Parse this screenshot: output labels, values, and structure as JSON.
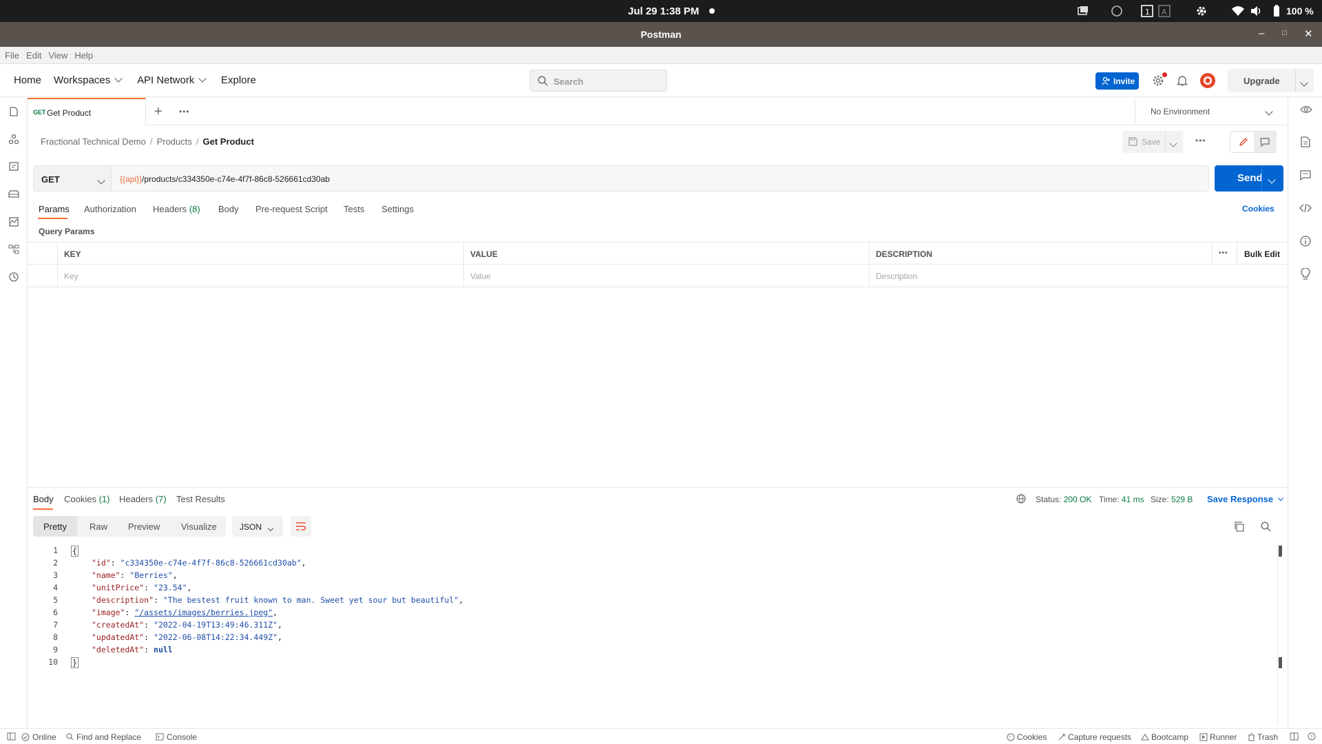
{
  "os": {
    "clock": "Jul 29  1:38 PM",
    "battery": "100 %"
  },
  "window": {
    "title": "Postman"
  },
  "menu": [
    "File",
    "Edit",
    "View",
    "Help"
  ],
  "header": {
    "nav": [
      "Home",
      "Workspaces",
      "API Network",
      "Explore"
    ],
    "search_placeholder": "Search",
    "invite": "Invite",
    "upgrade": "Upgrade"
  },
  "tab": {
    "method": "GET",
    "name": "Get Product"
  },
  "environment": "No Environment",
  "breadcrumb": [
    "Fractional Technical Demo",
    "Products",
    "Get Product"
  ],
  "toolbar": {
    "save": "Save"
  },
  "request": {
    "method": "GET",
    "url_var": "{{api}}",
    "url_path": "/products/c334350e-c74e-4f7f-86c8-526661cd30ab",
    "send": "Send"
  },
  "req_tabs": {
    "params": "Params",
    "authorization": "Authorization",
    "headers": "Headers",
    "headers_count": "(8)",
    "body": "Body",
    "prerequest": "Pre-request Script",
    "tests": "Tests",
    "settings": "Settings",
    "cookies": "Cookies"
  },
  "query_params": {
    "title": "Query Params",
    "headers": [
      "KEY",
      "VALUE",
      "DESCRIPTION"
    ],
    "bulk_edit": "Bulk Edit",
    "placeholders": [
      "Key",
      "Value",
      "Description"
    ]
  },
  "response": {
    "tabs": {
      "body": "Body",
      "cookies": "Cookies",
      "cookies_count": "(1)",
      "headers": "Headers",
      "headers_count": "(7)",
      "tests": "Test Results"
    },
    "status_label": "Status:",
    "status": "200 OK",
    "time_label": "Time:",
    "time": "41 ms",
    "size_label": "Size:",
    "size": "529 B",
    "save_response": "Save Response",
    "formats": [
      "Pretty",
      "Raw",
      "Preview",
      "Visualize"
    ],
    "language": "JSON",
    "lines": [
      {
        "n": "1",
        "text": "{"
      },
      {
        "n": "2",
        "key": "\"id\"",
        "value": "\"c334350e-c74e-4f7f-86c8-526661cd30ab\"",
        "tail": ","
      },
      {
        "n": "3",
        "key": "\"name\"",
        "value": "\"Berries\"",
        "tail": ","
      },
      {
        "n": "4",
        "key": "\"unitPrice\"",
        "value": "\"23.54\"",
        "tail": ","
      },
      {
        "n": "5",
        "key": "\"description\"",
        "value": "\"The bestest fruit known to man. Sweet yet sour but beautiful\"",
        "tail": ","
      },
      {
        "n": "6",
        "key": "\"image\"",
        "value": "\"/assets/images/berries.jpeg\"",
        "tail": ","
      },
      {
        "n": "7",
        "key": "\"createdAt\"",
        "value": "\"2022-04-19T13:49:46.311Z\"",
        "tail": ","
      },
      {
        "n": "8",
        "key": "\"updatedAt\"",
        "value": "\"2022-06-08T14:22:34.449Z\"",
        "tail": ","
      },
      {
        "n": "9",
        "key": "\"deletedAt\"",
        "value": "null",
        "tail": ""
      },
      {
        "n": "10",
        "text": "}"
      }
    ]
  },
  "footer": {
    "online": "Online",
    "find_replace": "Find and Replace",
    "console": "Console",
    "cookies": "Cookies",
    "capture": "Capture requests",
    "bootcamp": "Bootcamp",
    "runner": "Runner",
    "trash": "Trash"
  },
  "colors": {
    "accent": "#ff6c37",
    "primary": "#0265d2",
    "success": "#0c7a43"
  }
}
